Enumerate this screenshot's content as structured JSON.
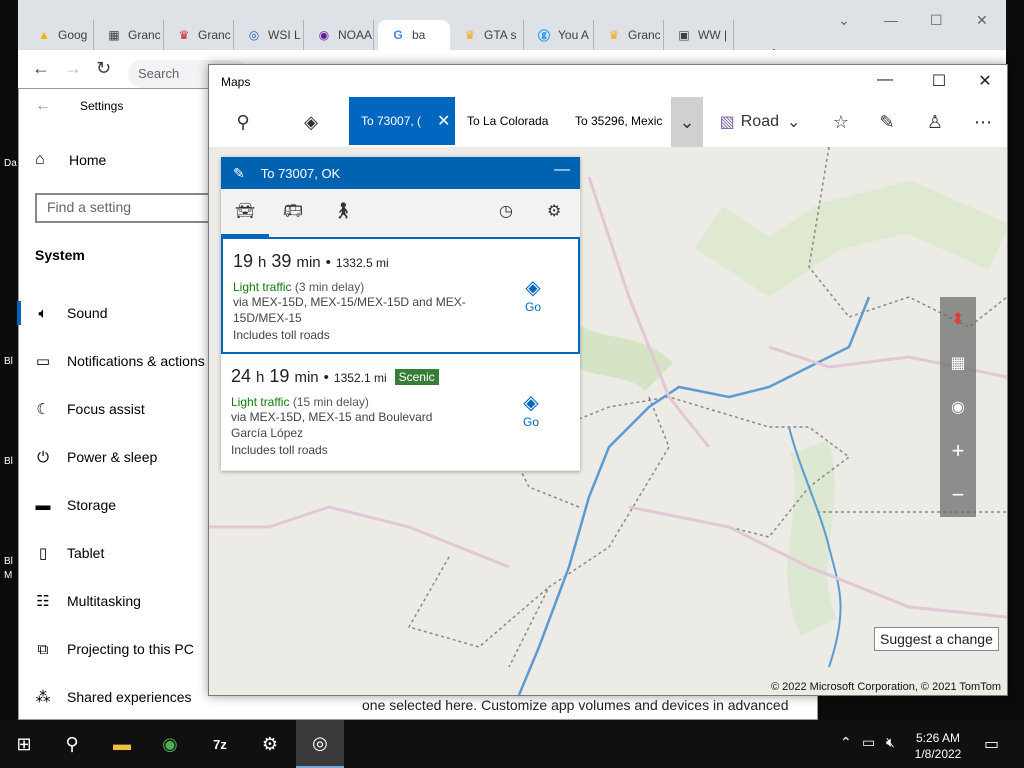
{
  "desktop": {
    "labels": [
      "Da",
      "Bl",
      "Bl",
      "Bl",
      "M"
    ]
  },
  "browser": {
    "tabs": [
      {
        "label": "Goog",
        "icon": "google-drive-icon"
      },
      {
        "label": "Granc",
        "icon": "newspaper-icon"
      },
      {
        "label": "Granc",
        "icon": "crown-icon"
      },
      {
        "label": "WSI L",
        "icon": "spiral-icon"
      },
      {
        "label": "NOAA",
        "icon": "radar-icon"
      },
      {
        "label": "ba",
        "icon": "google-g-icon"
      },
      {
        "label": "GTA s",
        "icon": "crown-icon"
      },
      {
        "label": "You A",
        "icon": "you-icon"
      },
      {
        "label": "Granc",
        "icon": "crown-icon"
      },
      {
        "label": "WW |",
        "icon": "weather-icon"
      }
    ],
    "new_tab": "+",
    "omnibox": "Search"
  },
  "settings": {
    "title": "Settings",
    "home": "Home",
    "search_placeholder": "Find a setting",
    "section": "System",
    "items": [
      {
        "label": "Sound",
        "icon": "speaker-icon"
      },
      {
        "label": "Notifications & actions",
        "icon": "notification-icon"
      },
      {
        "label": "Focus assist",
        "icon": "moon-icon"
      },
      {
        "label": "Power & sleep",
        "icon": "power-icon"
      },
      {
        "label": "Storage",
        "icon": "storage-icon"
      },
      {
        "label": "Tablet",
        "icon": "tablet-icon"
      },
      {
        "label": "Multitasking",
        "icon": "multitasking-icon"
      },
      {
        "label": "Projecting to this PC",
        "icon": "project-icon"
      },
      {
        "label": "Shared experiences",
        "icon": "share-icon"
      }
    ],
    "content_text": "one selected here. Customize app volumes and devices in advanced"
  },
  "maps": {
    "title": "Maps",
    "route_tabs": [
      "To 73007, (",
      "To La Colorada",
      "To 35296, Mexic"
    ],
    "style_label": "Road",
    "panel_title": "To 73007, OK",
    "routes": [
      {
        "hours": "19",
        "h": "h",
        "minutes": "39",
        "min": "min",
        "dist": "1332.5 mi",
        "traffic": "Light traffic",
        "delay": "(3 min delay)",
        "via": "via MEX-15D, MEX-15/MEX-15D and MEX-15D/MEX-15",
        "toll": "Includes toll roads",
        "go": "Go",
        "badge": ""
      },
      {
        "hours": "24",
        "h": "h",
        "minutes": "19",
        "min": "min",
        "dist": "1352.1 mi",
        "traffic": "Light traffic",
        "delay": "(15 min delay)",
        "via": "via MEX-15D, MEX-15 and Boulevard García López",
        "toll": "Includes toll roads",
        "go": "Go",
        "badge": "Scenic"
      }
    ],
    "suggest": "Suggest a change",
    "copyright": "© 2022 Microsoft Corporation, © 2021 TomTom"
  },
  "taskbar": {
    "time": "5:26 AM",
    "date": "1/8/2022",
    "apps": [
      "windows-start-icon",
      "search-icon",
      "file-explorer-icon",
      "chrome-icon",
      "7zip-icon",
      "settings-icon",
      "maps-icon"
    ]
  },
  "colors": {
    "accent": "#0067c0",
    "panel_header": "#0063b1",
    "traffic_green": "#107c10",
    "scenic_badge": "#3a7d3a"
  }
}
